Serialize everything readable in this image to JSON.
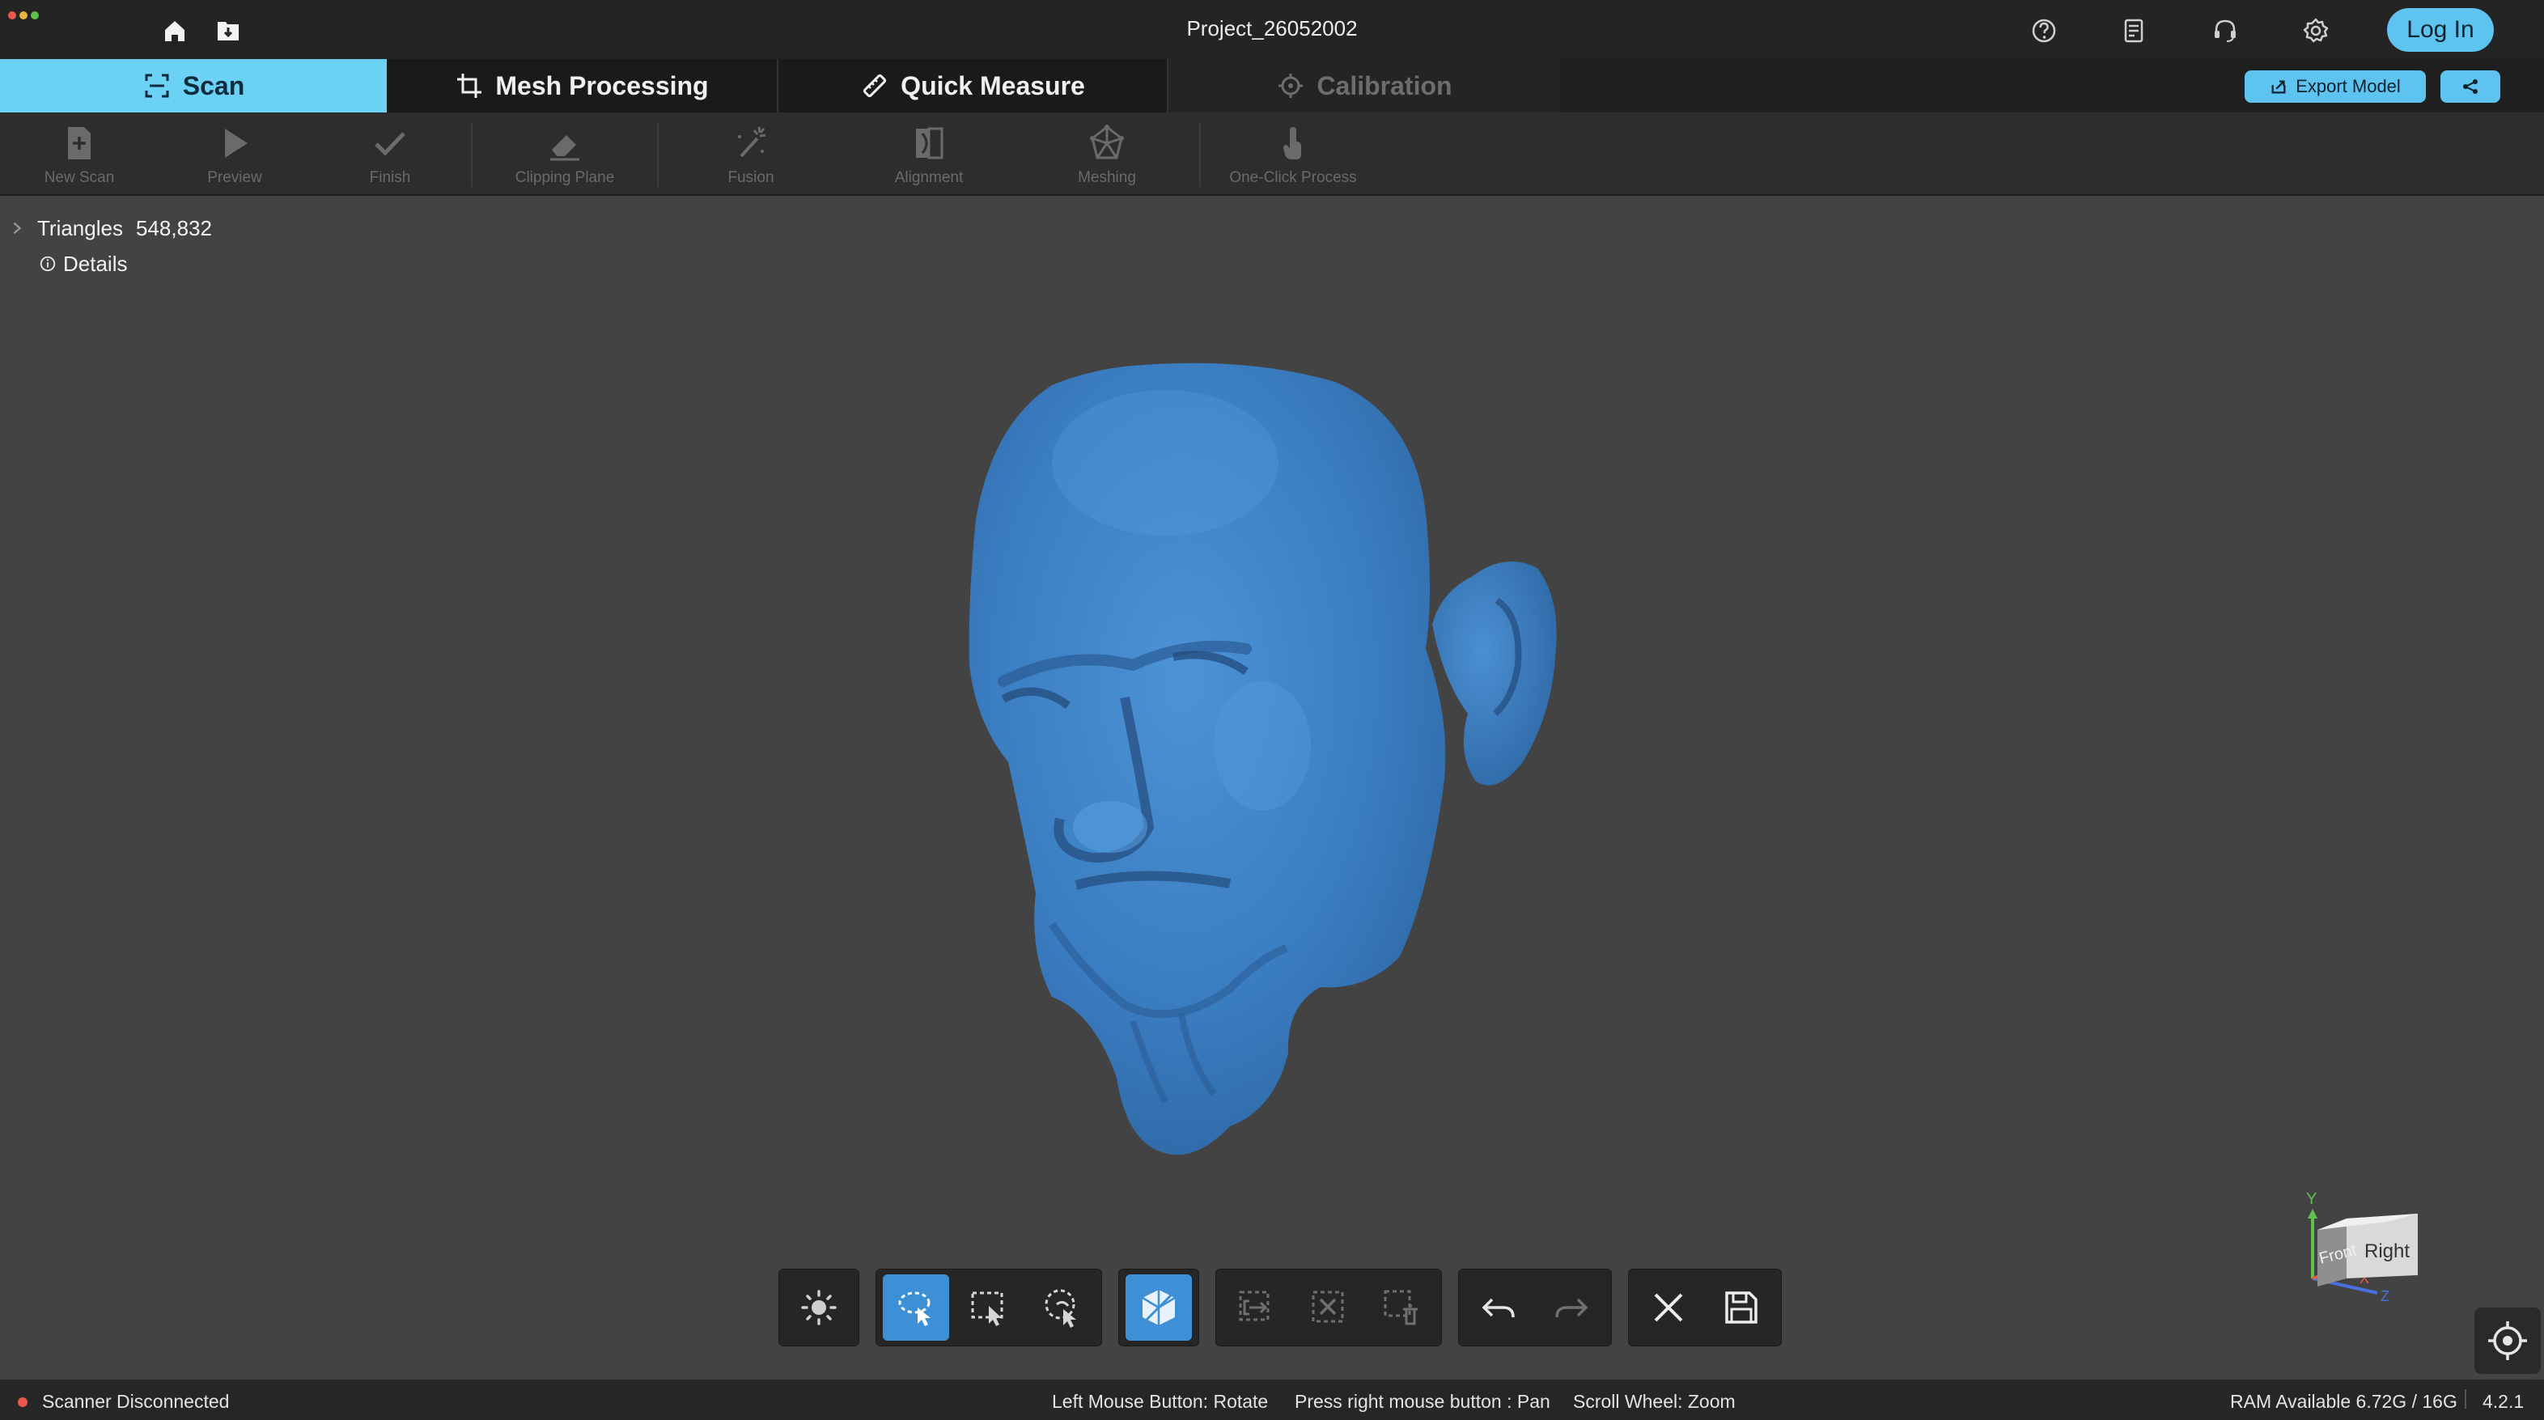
{
  "window": {
    "title": "Project_26052002",
    "login_label": "Log In",
    "traffic_colors": [
      "#e8584b",
      "#e9b43b",
      "#5fc04b"
    ]
  },
  "tabs": [
    {
      "label": "Scan",
      "state": "active"
    },
    {
      "label": "Mesh Processing",
      "state": "normal"
    },
    {
      "label": "Quick Measure",
      "state": "normal"
    },
    {
      "label": "Calibration",
      "state": "disabled"
    }
  ],
  "header_actions": {
    "export_label": "Export Model"
  },
  "toolbar": {
    "items": [
      {
        "label": "New Scan",
        "icon": "new-scan-icon"
      },
      {
        "label": "Preview",
        "icon": "preview-icon"
      },
      {
        "label": "Finish",
        "icon": "check-icon"
      },
      {
        "label": "Clipping Plane",
        "icon": "eraser-icon"
      },
      {
        "label": "Fusion",
        "icon": "fusion-icon"
      },
      {
        "label": "Alignment",
        "icon": "alignment-icon"
      },
      {
        "label": "Meshing",
        "icon": "meshing-icon"
      },
      {
        "label": "One-Click Process",
        "icon": "one-click-icon"
      }
    ]
  },
  "model_info": {
    "triangles_label": "Triangles",
    "triangles_value": "548,832",
    "details_label": "Details"
  },
  "nav_cube": {
    "front_label": "Front",
    "right_label": "Right",
    "y_axis_label": "Y",
    "x_axis_label": "X",
    "z_axis_label": "Z"
  },
  "status": {
    "scanner": "Scanner Disconnected",
    "hint_left": "Left Mouse Button: Rotate",
    "hint_right": "Press right mouse button : Pan",
    "hint_scroll": "Scroll Wheel: Zoom",
    "ram": "RAM Available 6.72G / 16G",
    "version": "4.2.1"
  },
  "colors": {
    "accent": "#6bd1f5",
    "mesh": "#3d7fc4",
    "viewport_bg": "#434343",
    "status_dot": "#e8584b"
  }
}
